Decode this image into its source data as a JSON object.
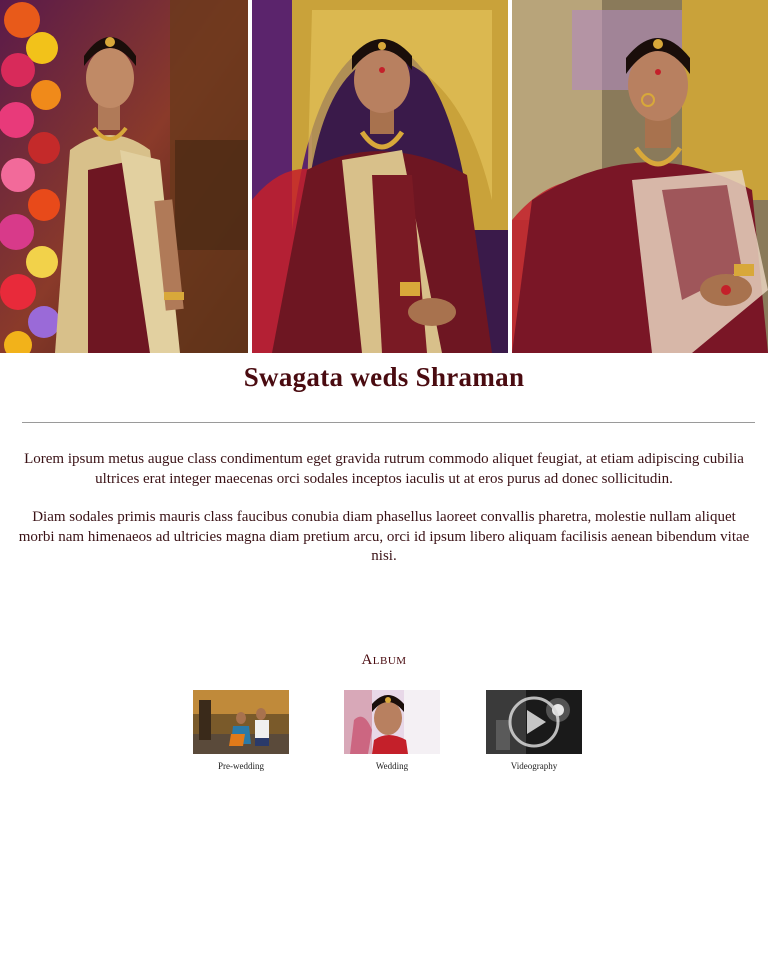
{
  "header": {
    "title": "Swagata weds Shraman"
  },
  "intro": {
    "paragraph_1": "Lorem ipsum metus augue class condimentum eget gravida rutrum commodo aliquet feugiat, at etiam adipiscing cubilia ultrices erat integer maecenas orci sodales inceptos iaculis ut at eros purus ad donec sollicitudin.",
    "paragraph_2": "Diam sodales primis mauris class faucibus conubia diam phasellus laoreet convallis pharetra, molestie nullam aliquet morbi nam himenaeos ad ultricies magna diam pretium arcu, orci id ipsum libero aliquam facilisis aenean bibendum vitae nisi."
  },
  "album": {
    "heading": "Album",
    "items": [
      {
        "caption": "Pre-wedding",
        "icon": "photo-thumbnail"
      },
      {
        "caption": "Wedding",
        "icon": "photo-thumbnail"
      },
      {
        "caption": "Videography",
        "icon": "play-icon"
      }
    ]
  },
  "colors": {
    "title": "#4a0b10",
    "saree_maroon": "#6e1622",
    "gold": "#c9a23a",
    "divider": "#9a9a9a"
  }
}
